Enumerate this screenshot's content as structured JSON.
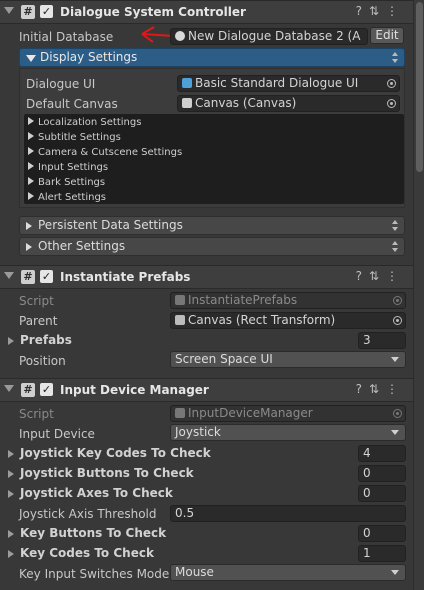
{
  "dsc": {
    "title": "Dialogue System Controller",
    "initial_database_label": "Initial Database",
    "initial_database_value": "New Dialogue Database 2 (A",
    "edit_label": "Edit",
    "display_settings": "Display Settings",
    "dialogue_ui_label": "Dialogue UI",
    "dialogue_ui_value": "Basic Standard Dialogue UI",
    "default_canvas_label": "Default Canvas",
    "default_canvas_value": "Canvas (Canvas)",
    "sub_sections": [
      "Localization Settings",
      "Subtitle Settings",
      "Camera & Cutscene Settings",
      "Input Settings",
      "Bark Settings",
      "Alert Settings"
    ],
    "persistent_data": "Persistent Data Settings",
    "other_settings": "Other Settings"
  },
  "instantiate": {
    "title": "Instantiate Prefabs",
    "script_label": "Script",
    "script_value": "InstantiatePrefabs",
    "parent_label": "Parent",
    "parent_value": "Canvas (Rect Transform)",
    "prefabs_label": "Prefabs",
    "prefabs_value": "3",
    "position_label": "Position",
    "position_value": "Screen Space UI"
  },
  "idm": {
    "title": "Input Device Manager",
    "script_label": "Script",
    "script_value": "InputDeviceManager",
    "input_device_label": "Input Device",
    "input_device_value": "Joystick",
    "jk_label": "Joystick Key Codes To Check",
    "jk_value": "4",
    "jb_label": "Joystick Buttons To Check",
    "jb_value": "0",
    "ja_label": "Joystick Axes To Check",
    "ja_value": "0",
    "jat_label": "Joystick Axis Threshold",
    "jat_value": "0.5",
    "kb_label": "Key Buttons To Check",
    "kb_value": "0",
    "kc_label": "Key Codes To Check",
    "kc_value": "1",
    "kis_label": "Key Input Switches Mode T",
    "kis_value": "Mouse"
  },
  "colors": {
    "accent_blue": "#2c5d87",
    "annotation_red": "#e01818",
    "background": "#383838"
  }
}
